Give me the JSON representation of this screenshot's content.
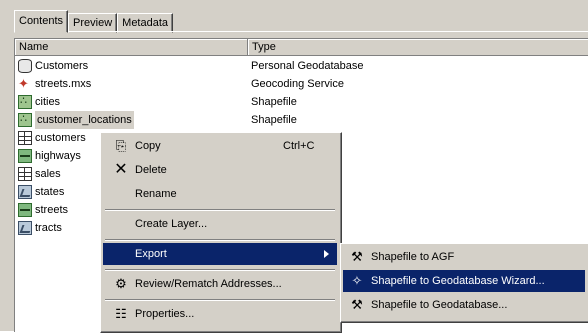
{
  "tabs": [
    {
      "label": "Contents",
      "active": true
    },
    {
      "label": "Preview",
      "active": false
    },
    {
      "label": "Metadata",
      "active": false
    }
  ],
  "columns": {
    "name": "Name",
    "type": "Type"
  },
  "items": [
    {
      "name": "Customers",
      "type": "Personal Geodatabase",
      "icon": "geodatabase-icon"
    },
    {
      "name": "streets.mxs",
      "type": "Geocoding Service",
      "icon": "geocoding-service-icon"
    },
    {
      "name": "cities",
      "type": "Shapefile",
      "icon": "point-shapefile-icon"
    },
    {
      "name": "customer_locations",
      "type": "Shapefile",
      "icon": "point-shapefile-icon",
      "selected": true
    },
    {
      "name": "customers",
      "type": "",
      "icon": "table-icon"
    },
    {
      "name": "highways",
      "type": "",
      "icon": "line-shapefile-icon"
    },
    {
      "name": "sales",
      "type": "",
      "icon": "table-icon"
    },
    {
      "name": "states",
      "type": "",
      "icon": "polygon-shapefile-icon"
    },
    {
      "name": "streets",
      "type": "",
      "icon": "line-shapefile-icon"
    },
    {
      "name": "tracts",
      "type": "",
      "icon": "polygon-shapefile-icon"
    }
  ],
  "context_menu": {
    "copy": {
      "label": "Copy",
      "shortcut": "Ctrl+C"
    },
    "delete": {
      "label": "Delete"
    },
    "rename": {
      "label": "Rename"
    },
    "create_layer": {
      "label": "Create Layer..."
    },
    "export": {
      "label": "Export",
      "highlighted": true
    },
    "review": {
      "label": "Review/Rematch Addresses..."
    },
    "properties": {
      "label": "Properties..."
    }
  },
  "submenu": {
    "agf": {
      "label": "Shapefile to AGF"
    },
    "wizard": {
      "label": "Shapefile to Geodatabase Wizard...",
      "highlighted": true
    },
    "gdb": {
      "label": "Shapefile to Geodatabase..."
    }
  },
  "colors": {
    "highlight": "#0a246a",
    "face": "#d4d0c8"
  }
}
